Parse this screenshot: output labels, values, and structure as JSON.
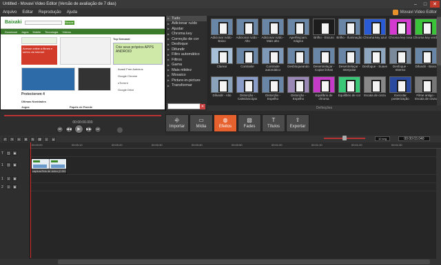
{
  "window": {
    "title": "Untitled - Movavi Video Editor (Versão de avaliação de 7 dias)",
    "minimize": "–",
    "maximize": "□",
    "close": "✕"
  },
  "menu": {
    "items": [
      "Arquivo",
      "Editar",
      "Reprodução",
      "Ajuda"
    ],
    "brand": "Movavi Video Editor"
  },
  "preview": {
    "site_name": "Baixaki",
    "search_button": "Buscar",
    "nav_items": [
      "Download",
      "Jogos",
      "Mobile",
      "Tecnologia",
      "Vídeos"
    ],
    "banner_text": "Acesse online a filmes e séries via internet",
    "ad_text": "Crie seus próprios APPS ANDROID",
    "section1": "Protectorom 4",
    "section2": "Últimas Novidades",
    "section3": "Top Semanal",
    "section4": "Jogos",
    "section5": "Papéis de Parede",
    "top_items": [
      "Avast! Free Antivirus",
      "Google Chrome",
      "uTorrent",
      "Google Drive"
    ]
  },
  "effect_categories": {
    "items": [
      {
        "label": "Tudo",
        "selected": true
      },
      {
        "label": "Adicionar ruído",
        "selected": false
      },
      {
        "label": "Ajustar",
        "selected": false
      },
      {
        "label": "Chroma key",
        "selected": false
      },
      {
        "label": "Correção de cor",
        "selected": false
      },
      {
        "label": "Desfoque",
        "selected": false
      },
      {
        "label": "Difundir",
        "selected": false
      },
      {
        "label": "Filtro automático",
        "selected": false
      },
      {
        "label": "Filtros",
        "selected": false
      },
      {
        "label": "Gama",
        "selected": false
      },
      {
        "label": "Mais nitidez",
        "selected": false
      },
      {
        "label": "Mosaico",
        "selected": false
      },
      {
        "label": "Picture-in-picture",
        "selected": false
      },
      {
        "label": "Transformar",
        "selected": false
      }
    ],
    "search_clear": "✕"
  },
  "effects": {
    "rows": [
      [
        "Adicionar ruído - Baixo",
        "Adicionar ruído - Alto",
        "Adicionar ruído - Mais alto",
        "Aperfeiçoam. mágico",
        "Brilho - Escuro",
        "Brilho - Iluminação",
        "Chroma key azul",
        "Chroma key rosa",
        "Chroma key verde"
      ],
      [
        "Clarear",
        "Contraste",
        "Contraste automático",
        "Desbloqueando",
        "Desentrelaçar - Copiar linhas",
        "Desentrelaçar - Interpolar",
        "Desfoque - Suave",
        "Desfoque - Intenso",
        "Difundir - Baixo"
      ],
      [
        "Difundir - Alto",
        "Distorção - Caleidoscópio",
        "Distorção - Espelho",
        "Distorção - Espelho",
        "Equilíbrio de chroma",
        "Equilíbrio de cor",
        "Escala de cinza",
        "Executar posterização",
        "Filme antigo - Escala de cinza"
      ]
    ],
    "definitions_label": "Definições"
  },
  "playback": {
    "timecode": "00:00:00.000",
    "progress": 0,
    "buttons": [
      "⏮",
      "◀◀",
      "▶",
      "▶▶",
      "⏭"
    ]
  },
  "toolbar": {
    "buttons": [
      {
        "label": "Importar",
        "icon": "⎆",
        "active": false
      },
      {
        "label": "Mídia",
        "icon": "▭",
        "active": false
      },
      {
        "label": "Efeitos",
        "icon": "◍",
        "active": true
      },
      {
        "label": "Fades",
        "icon": "▧",
        "active": false
      },
      {
        "label": "Títulos",
        "icon": "T",
        "active": false
      },
      {
        "label": "Exportar",
        "icon": "⇪",
        "active": false
      }
    ]
  },
  "timeline": {
    "tools": [
      "↶",
      "↷",
      "✂",
      "⊞",
      "✎",
      "⌫",
      "♪",
      "⌀"
    ],
    "zoom_value": "10 seg",
    "current_time": "00:00:03.040",
    "ruler_ticks": [
      "00:00:00",
      "00:00:10",
      "00:00:20",
      "00:00:30",
      "00:00:40",
      "00:00:50",
      "00:01:00",
      "00:01:10",
      "00:01:20",
      "00:01:30"
    ],
    "track_labels": [
      "T",
      "1",
      "1",
      "2"
    ],
    "clip_name": "capturaTela de video (0:00:04)"
  }
}
